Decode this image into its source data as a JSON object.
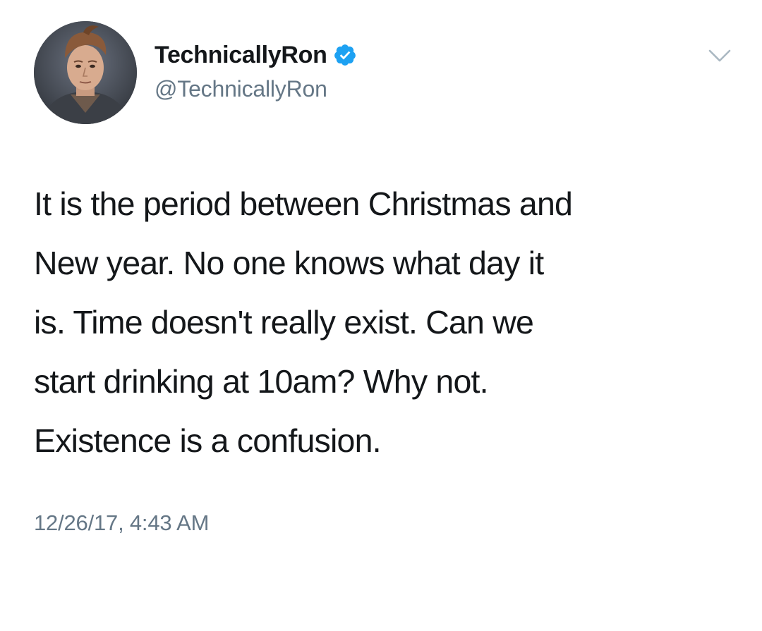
{
  "tweet": {
    "author": {
      "display_name": "TechnicallyRon",
      "handle": "@TechnicallyRon",
      "verified": true,
      "avatar_icon": "avatar-portrait-icon"
    },
    "menu_icon": "chevron-down-icon",
    "text_lines": [
      "It is the period between Christmas and",
      "New year. No one knows what day it",
      "is. Time doesn't really exist. Can we",
      "start drinking at 10am? Why not.",
      "Existence is a confusion."
    ],
    "timestamp": "12/26/17, 4:43 AM"
  },
  "colors": {
    "text_primary": "#14171a",
    "text_secondary": "#657786",
    "verified_blue": "#1da1f2",
    "caret_gray": "#aab8c2",
    "background": "#ffffff"
  }
}
